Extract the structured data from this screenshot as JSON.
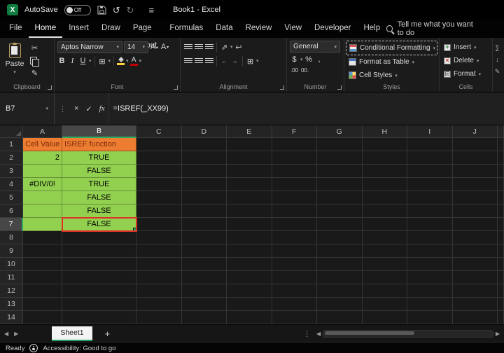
{
  "titlebar": {
    "app_icon": "X",
    "autosave_label": "AutoSave",
    "autosave_state": "Off",
    "title": "Book1 - Excel"
  },
  "menu": {
    "tabs": [
      "File",
      "Home",
      "Insert",
      "Draw",
      "Page Layout",
      "Formulas",
      "Data",
      "Review",
      "View",
      "Developer",
      "Help"
    ],
    "active_tab": "Home",
    "search_text": "Tell me what you want to do"
  },
  "ribbon": {
    "clipboard": {
      "paste_label": "Paste",
      "label": "Clipboard"
    },
    "font": {
      "font_name": "Aptos Narrow",
      "font_size": "14",
      "bold": "B",
      "italic": "I",
      "underline": "U",
      "label": "Font"
    },
    "alignment": {
      "label": "Alignment"
    },
    "number": {
      "format": "General",
      "accounting": "$",
      "percent": "%",
      "comma": ",",
      "inc_decimal": ".00",
      "dec_decimal": "00.",
      "label": "Number"
    },
    "styles": {
      "conditional_formatting": "Conditional Formatting",
      "format_as_table": "Format as Table",
      "cell_styles": "Cell Styles",
      "label": "Styles"
    },
    "cells": {
      "insert": "Insert",
      "delete": "Delete",
      "format": "Format",
      "label": "Cells"
    }
  },
  "formula_bar": {
    "name_box": "B7",
    "formula": "=ISREF(_XX99)"
  },
  "sheet": {
    "col_headers": [
      "A",
      "B",
      "C",
      "D",
      "E",
      "F",
      "G",
      "H",
      "I",
      "J"
    ],
    "num_rows": 14,
    "selected": {
      "ref": "B7",
      "col": 1,
      "row": 6
    },
    "cells": [
      {
        "c": 0,
        "r": 0,
        "t": "Cell Value",
        "cls": "orange"
      },
      {
        "c": 1,
        "r": 0,
        "t": "ISREF function",
        "cls": "orange"
      },
      {
        "c": 0,
        "r": 1,
        "t": "2",
        "cls": "green right"
      },
      {
        "c": 1,
        "r": 1,
        "t": "TRUE",
        "cls": "green center"
      },
      {
        "c": 0,
        "r": 2,
        "t": "",
        "cls": "green"
      },
      {
        "c": 1,
        "r": 2,
        "t": "FALSE",
        "cls": "green center"
      },
      {
        "c": 0,
        "r": 3,
        "t": "#DIV/0!",
        "cls": "green center"
      },
      {
        "c": 1,
        "r": 3,
        "t": "TRUE",
        "cls": "green center"
      },
      {
        "c": 0,
        "r": 4,
        "t": "",
        "cls": "green"
      },
      {
        "c": 1,
        "r": 4,
        "t": "FALSE",
        "cls": "green center"
      },
      {
        "c": 0,
        "r": 5,
        "t": "",
        "cls": "green"
      },
      {
        "c": 1,
        "r": 5,
        "t": "FALSE",
        "cls": "green center"
      },
      {
        "c": 0,
        "r": 6,
        "t": "",
        "cls": "green"
      },
      {
        "c": 1,
        "r": 6,
        "t": "FALSE",
        "cls": "green center"
      }
    ]
  },
  "sheet_bar": {
    "tabs": [
      "Sheet1"
    ],
    "active_tab": "Sheet1",
    "add_label": "+"
  },
  "status_bar": {
    "ready": "Ready",
    "accessibility": "Accessibility: Good to go"
  },
  "colors": {
    "orange_fill": "#ED7D31",
    "green_fill": "#92D050",
    "annotation_red": "#E03127",
    "excel_green": "#107C41"
  }
}
